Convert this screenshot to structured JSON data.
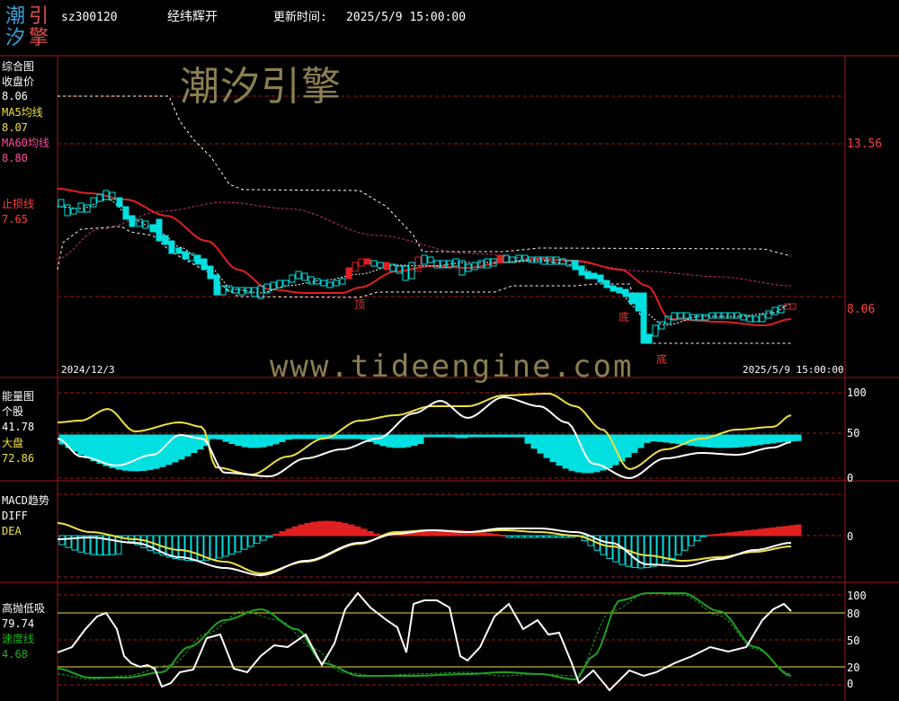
{
  "header": {
    "logo_chars": [
      "潮",
      "引",
      "汐",
      "擎"
    ],
    "code": "sz300120",
    "name": "经纬辉开",
    "update_label": "更新时间:",
    "update_time": "2025/5/9 15:00:00"
  },
  "watermark": {
    "cn": "潮汐引擎",
    "url": "www.tideengine.com"
  },
  "panels": {
    "main": {
      "title": "综合图",
      "close_label": "收盘价",
      "close_value": "8.06",
      "ma5_label": "MA5均线",
      "ma5_value": "8.07",
      "ma60_label": "MA60均线",
      "ma60_value": "8.80",
      "stop_label": "止损线",
      "stop_value": "7.65",
      "axis_top": "13.56",
      "axis_mid": "8.06",
      "date_start": "2024/12/3",
      "date_end": "2025/5/9 15:00:00",
      "marks": [
        "顶",
        "底",
        "底"
      ]
    },
    "energy": {
      "title": "能量图",
      "stock_label": "个股",
      "stock_value": "41.78",
      "market_label": "大盘",
      "market_value": "72.86",
      "axis": [
        "100",
        "50",
        "0"
      ]
    },
    "macd": {
      "title": "MACD趋势",
      "diff_label": "DIFF",
      "dea_label": "DEA",
      "axis": [
        "0"
      ]
    },
    "hilo": {
      "title": "高抛低吸",
      "value": "79.74",
      "speed_label": "速度线",
      "speed_value": "4.68",
      "axis": [
        "100",
        "80",
        "50",
        "20",
        "0"
      ]
    }
  },
  "colors": {
    "bg": "#000000",
    "frame": "#a01818",
    "red": "#e02020",
    "cyan": "#00e0e0",
    "yellow": "#f0e040",
    "white": "#ffffff",
    "magenta": "#c03070",
    "green": "#20a020",
    "label_yellow": "#f0e040",
    "label_red": "#ff4040",
    "label_green": "#20b020"
  }
}
